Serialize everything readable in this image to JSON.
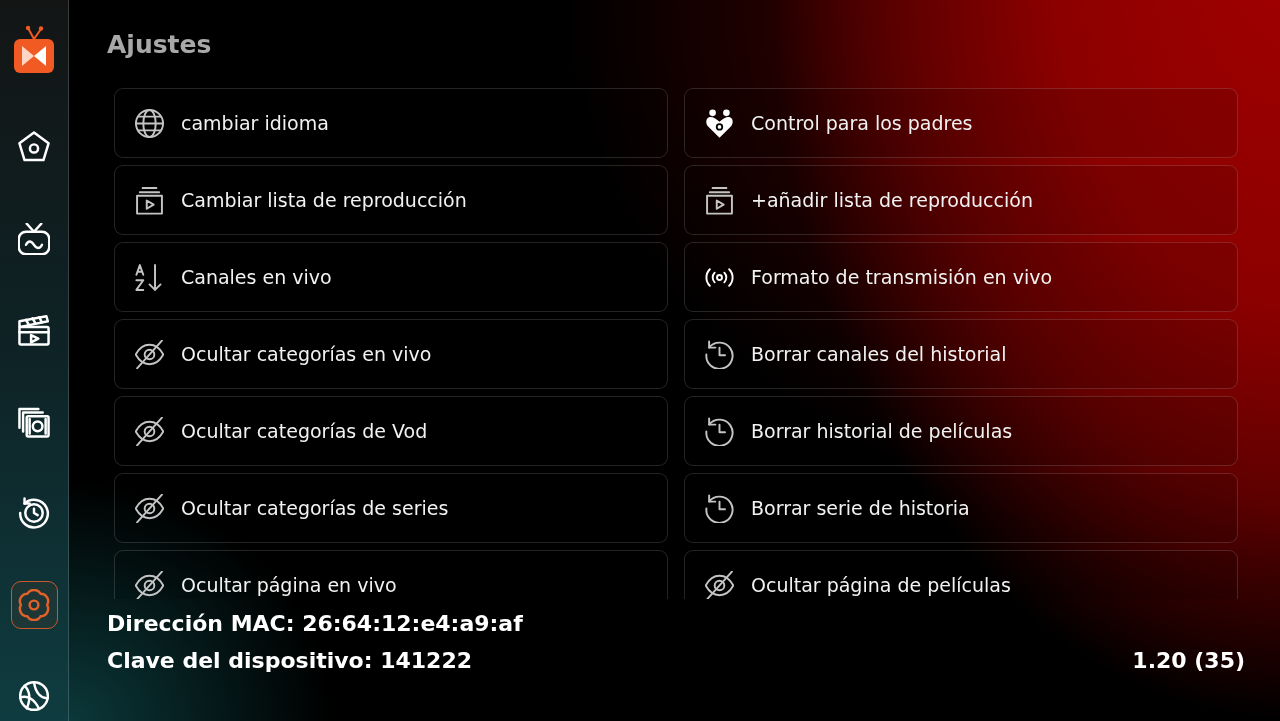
{
  "sidebar": {
    "items": [
      {
        "kind": "home",
        "selected": false
      },
      {
        "kind": "live_tv",
        "selected": false
      },
      {
        "kind": "movies",
        "selected": false
      },
      {
        "kind": "series",
        "selected": false
      },
      {
        "kind": "history",
        "selected": false
      },
      {
        "kind": "settings",
        "selected": true
      },
      {
        "kind": "sports",
        "selected": false
      }
    ]
  },
  "title": "Ajustes",
  "options": [
    {
      "kind": "language",
      "label": "cambiar idioma"
    },
    {
      "kind": "parental",
      "label": "Control para los padres"
    },
    {
      "kind": "playlist",
      "label": "Cambiar lista de reproducción"
    },
    {
      "kind": "playlist",
      "label": "+añadir lista de reproducción"
    },
    {
      "kind": "sort",
      "label": "Canales en vivo"
    },
    {
      "kind": "stream",
      "label": "Formato de transmisión en vivo"
    },
    {
      "kind": "hide",
      "label": "Ocultar categorías en vivo"
    },
    {
      "kind": "history",
      "label": "Borrar canales del historial"
    },
    {
      "kind": "hide",
      "label": "Ocultar categorías de Vod"
    },
    {
      "kind": "history",
      "label": "Borrar historial de películas"
    },
    {
      "kind": "hide",
      "label": "Ocultar categorías de series"
    },
    {
      "kind": "history",
      "label": "Borrar serie de historia"
    },
    {
      "kind": "hide",
      "label": "Ocultar página en vivo"
    },
    {
      "kind": "hide",
      "label": "Ocultar página de películas"
    }
  ],
  "device": {
    "mac": "Dirección MAC: 26:64:12:e4:a9:af",
    "key": "Clave del dispositivo: 141222"
  },
  "version": "1.20 (35)"
}
